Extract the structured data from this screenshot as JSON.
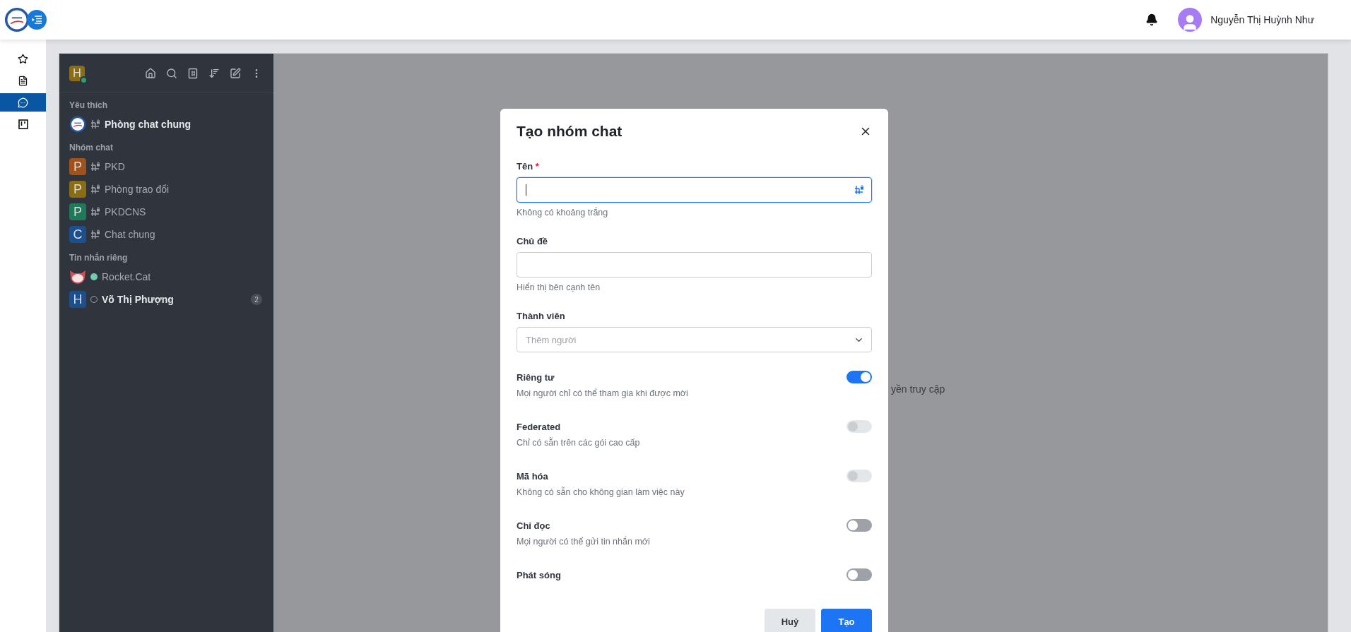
{
  "header": {
    "user_name": "Nguyễn Thị Huỳnh Như"
  },
  "rail": {
    "items": [
      {
        "kind": "star",
        "selected": false
      },
      {
        "kind": "document",
        "selected": false
      },
      {
        "kind": "chat",
        "selected": true
      },
      {
        "kind": "board",
        "selected": false
      }
    ]
  },
  "sidebar": {
    "user": {
      "letter": "H",
      "color": "#8b6d16",
      "online": true
    },
    "sections": [
      {
        "title": "Yêu thích",
        "items": [
          {
            "name": "Phòng chat chung",
            "avatar": {
              "kind": "logo"
            },
            "kind": "channel",
            "unread": true
          }
        ]
      },
      {
        "title": "Nhóm chat",
        "items": [
          {
            "name": "PKD",
            "avatar": {
              "kind": "letter",
              "letter": "P",
              "color": "#a0521c"
            },
            "kind": "channel",
            "unread": false
          },
          {
            "name": "Phòng trao đổi",
            "avatar": {
              "kind": "letter",
              "letter": "P",
              "color": "#8a6d12"
            },
            "kind": "channel",
            "unread": false
          },
          {
            "name": "PKDCNS",
            "avatar": {
              "kind": "letter",
              "letter": "P",
              "color": "#1f7a5a"
            },
            "kind": "channel",
            "unread": false
          },
          {
            "name": "Chat chung",
            "avatar": {
              "kind": "letter",
              "letter": "C",
              "color": "#1d4f8c"
            },
            "kind": "channel",
            "unread": false
          }
        ]
      },
      {
        "title": "Tin nhắn riêng",
        "items": [
          {
            "name": "Rocket.Cat",
            "avatar": {
              "kind": "cat"
            },
            "kind": "direct",
            "online": true,
            "unread": false
          },
          {
            "name": "Võ Thị Phượng",
            "avatar": {
              "kind": "letter",
              "letter": "H",
              "color": "#1d4f8c"
            },
            "kind": "direct",
            "online": false,
            "unread": true,
            "badge": "2"
          }
        ]
      }
    ]
  },
  "content": {
    "background_text": "yền truy cập"
  },
  "modal": {
    "title": "Tạo nhóm chat",
    "fields": [
      {
        "label": "Tên",
        "required_mark": "*",
        "kind": "channel-name",
        "focused": true,
        "hint": "Không có khoảng trắng"
      },
      {
        "label": "Chủ đề",
        "kind": "text",
        "focused": false,
        "hint": "Hiển thị bên cạnh tên"
      },
      {
        "label": "Thành viên",
        "kind": "select",
        "focused": false,
        "placeholder": "Thêm người"
      }
    ],
    "toggles": [
      {
        "label": "Riêng tư",
        "description": "Mọi người chỉ có thể tham gia khi được mời",
        "on": true,
        "disabled": false
      },
      {
        "label": "Federated",
        "description": "Chỉ có sẵn trên các gói cao cấp",
        "on": false,
        "disabled": true
      },
      {
        "label": "Mã hóa",
        "description": "Không có sẵn cho không gian làm việc này",
        "on": false,
        "disabled": true
      },
      {
        "label": "Chỉ đọc",
        "description": "Mọi người có thể gửi tin nhắn mới",
        "on": false,
        "disabled": false
      },
      {
        "label": "Phát sóng",
        "on": false,
        "disabled": false
      }
    ],
    "buttons": [
      {
        "label": "Huỷ",
        "kind": "secondary"
      },
      {
        "label": "Tạo",
        "kind": "primary"
      }
    ]
  }
}
